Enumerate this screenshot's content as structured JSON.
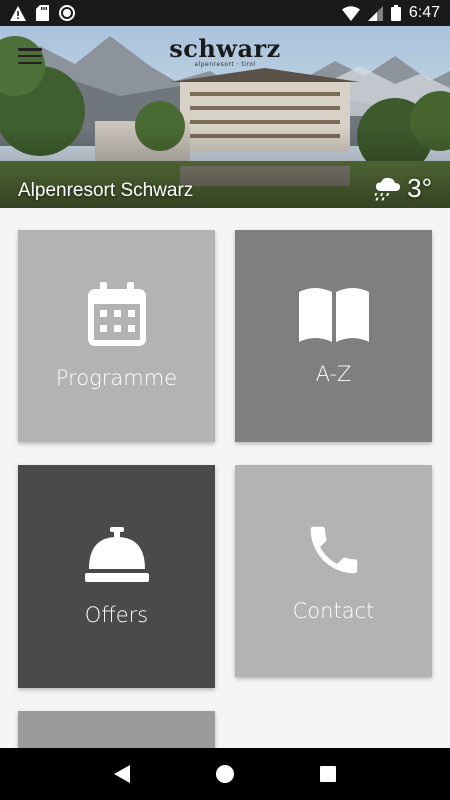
{
  "status_bar": {
    "time": "6:47",
    "icons": [
      "warning-icon",
      "sd-card-icon",
      "circle-icon",
      "wifi-icon",
      "signal-icon",
      "battery-icon"
    ]
  },
  "header": {
    "brand_wordmark": "schwarz",
    "brand_tagline": "alpenresort · tirol",
    "hotel_name": "Alpenresort Schwarz",
    "weather_temp": "3°",
    "weather_icon": "cloud-rain-icon"
  },
  "tiles": [
    {
      "label": "Programme",
      "icon": "calendar-icon",
      "color": "#b3b3b3"
    },
    {
      "label": "A-Z",
      "icon": "book-icon",
      "color": "#7f7f7f"
    },
    {
      "label": "Offers",
      "icon": "service-bell-icon",
      "color": "#4a4a4a"
    },
    {
      "label": "Contact",
      "icon": "phone-icon",
      "color": "#b3b3b3"
    },
    {
      "label": "",
      "icon": "",
      "color": "#9b9b9b"
    }
  ],
  "nav": {
    "back": "back-icon",
    "home": "home-icon",
    "recents": "recents-icon"
  }
}
